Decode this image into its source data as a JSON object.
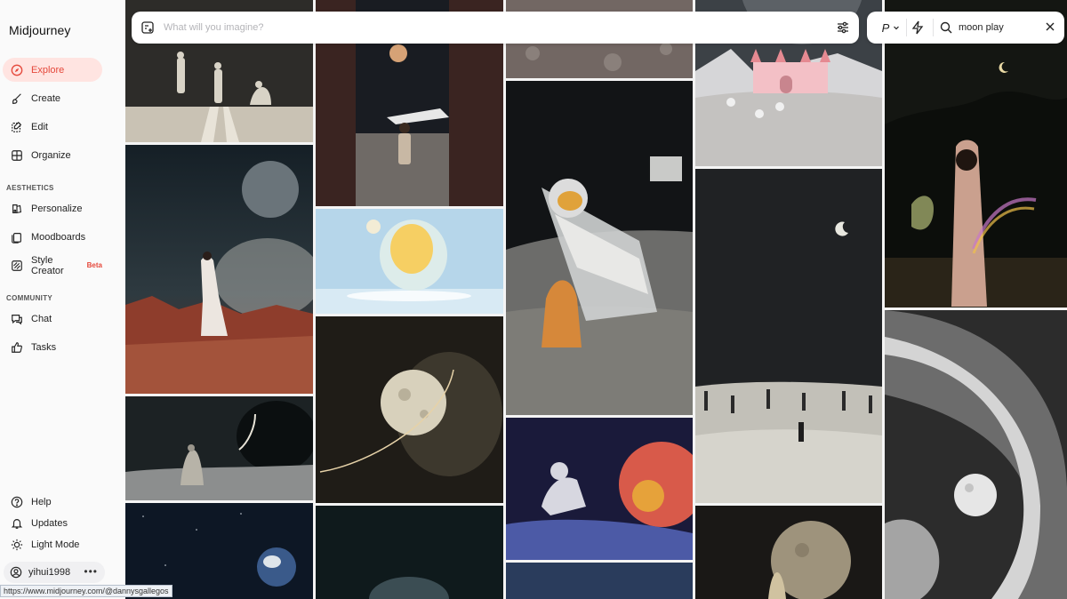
{
  "brand": "Midjourney",
  "nav": {
    "explore": "Explore",
    "create": "Create",
    "edit": "Edit",
    "organize": "Organize",
    "aesthetics_label": "AESTHETICS",
    "personalize": "Personalize",
    "moodboards": "Moodboards",
    "style_creator": "Style Creator",
    "style_creator_badge": "Beta",
    "community_label": "COMMUNITY",
    "chat": "Chat",
    "tasks": "Tasks",
    "help": "Help",
    "updates": "Updates",
    "light_mode": "Light Mode",
    "username": "yihui1998",
    "more": "•••"
  },
  "search": {
    "placeholder": "What will you imagine?"
  },
  "filter": {
    "personalize_toggle": "P",
    "query": "moon play"
  },
  "status_url": "https://www.midjourney.com/@dannysgallegos",
  "colors": {
    "accent": "#e5483b",
    "active_bg": "#ffe4e1"
  }
}
